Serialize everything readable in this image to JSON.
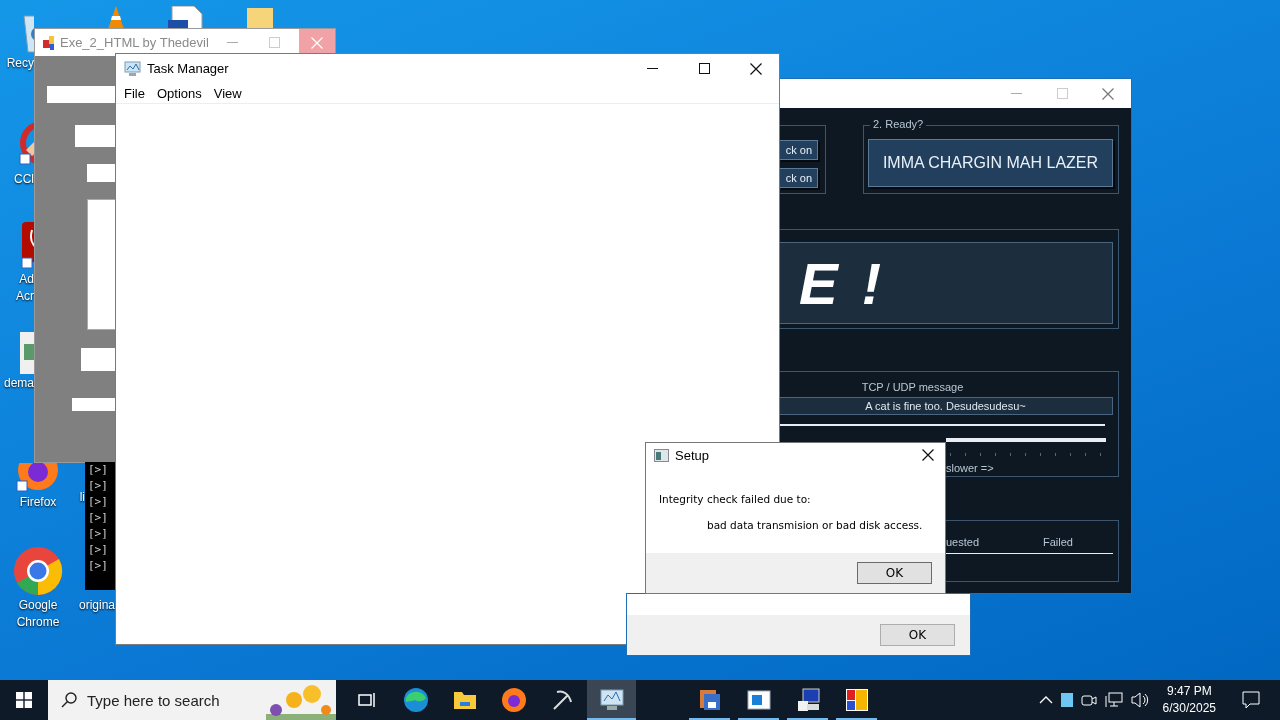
{
  "desktop": {
    "icons": [
      {
        "kind": "recycle",
        "lines": [
          "Recy"
        ]
      },
      {
        "kind": "vlc"
      },
      {
        "kind": "document"
      },
      {
        "kind": "folder"
      },
      {
        "kind": "cleaner",
        "lines": [
          "CCl"
        ]
      },
      {
        "kind": "acrobat",
        "lines": [
          "Ad",
          "Acr"
        ]
      },
      {
        "kind": "image",
        "lines": [
          "dema"
        ]
      },
      {
        "kind": "firefox",
        "lines": [
          "Firefox"
        ]
      },
      {
        "kind": "blank",
        "lines": [
          "li"
        ]
      },
      {
        "kind": "chrome",
        "lines": [
          "Google",
          "Chrome"
        ]
      },
      {
        "kind": "blank",
        "lines": [
          "origina"
        ]
      }
    ]
  },
  "exe_window": {
    "title": "Exe_2_HTML by Thedevil"
  },
  "console": {
    "lines": [
      "[>]",
      "[>]",
      "[>]",
      "[>]",
      "[>]",
      "[>]",
      "[>]"
    ]
  },
  "loic_window": {
    "left_buttons": [
      "ck on",
      "ck on"
    ],
    "ready_legend": "2. Ready?",
    "fire_button": "IMMA CHARGIN MAH LAZER",
    "banner": "E !",
    "message_label": "TCP / UDP message",
    "message_value": "A cat is fine too. Desudesudesu~",
    "speed_slider": {
      "level": 1
    },
    "speed_label": "slower =>",
    "columns": [
      "uested",
      "Failed"
    ]
  },
  "back_dialog": {
    "button": "OK"
  },
  "task_manager": {
    "title": "Task Manager",
    "menu": [
      "File",
      "Options",
      "View"
    ]
  },
  "setup_dialog": {
    "title": "Setup",
    "message": "Integrity check failed due to:",
    "detail": "bad data transmision or bad disk access.",
    "button": "OK"
  },
  "taskbar": {
    "search": {
      "placeholder": "Type here to search"
    },
    "pinned": [
      {
        "kind": "task-view",
        "running": false,
        "selected": false
      },
      {
        "kind": "edge",
        "running": false,
        "selected": false
      },
      {
        "kind": "folder",
        "running": false,
        "selected": false
      },
      {
        "kind": "firefox",
        "running": false,
        "selected": false
      },
      {
        "kind": "pickaxe",
        "running": false,
        "selected": false
      },
      {
        "kind": "monitor",
        "running": true,
        "selected": true
      }
    ],
    "open": [
      {
        "kind": "floppy",
        "running": true,
        "selected": false
      },
      {
        "kind": "window",
        "running": true,
        "selected": false
      },
      {
        "kind": "computer",
        "running": true,
        "selected": false
      },
      {
        "kind": "colors",
        "running": true,
        "selected": false
      }
    ],
    "time": "9:47 PM",
    "date": "6/30/2025"
  }
}
